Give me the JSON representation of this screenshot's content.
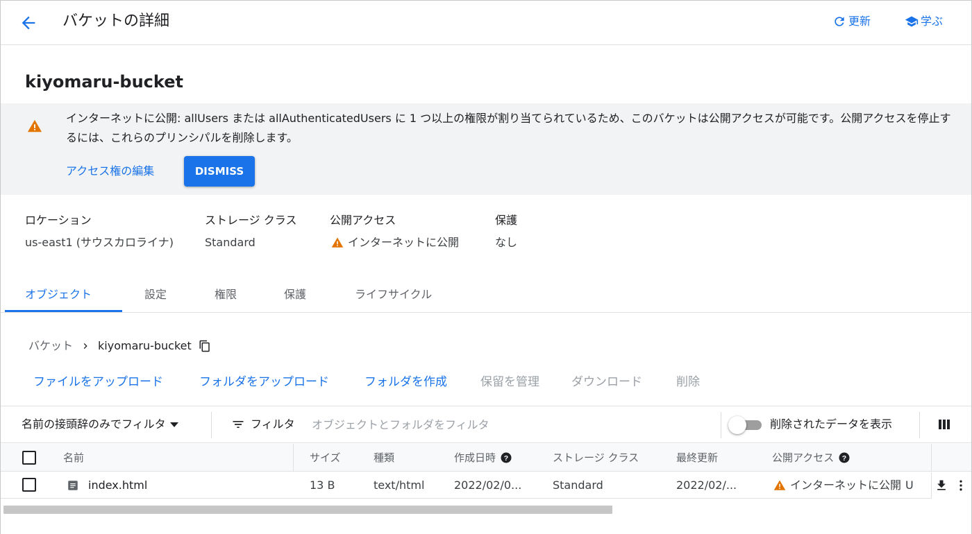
{
  "header": {
    "title": "バケットの詳細",
    "refresh_label": "更新",
    "learn_label": "学ぶ"
  },
  "bucket": {
    "name": "kiyomaru-bucket"
  },
  "banner": {
    "message": "インターネットに公開: allUsers または allAuthenticatedUsers に 1 つ以上の権限が割り当てられているため、このバケットは公開アクセスが可能です。公開アクセスを停止するには、これらのプリンシパルを削除します。",
    "edit_link": "アクセス権の編集",
    "dismiss": "DISMISS"
  },
  "info": {
    "location_label": "ロケーション",
    "location_value": "us-east1 (サウスカロライナ)",
    "storage_label": "ストレージ クラス",
    "storage_value": "Standard",
    "public_label": "公開アクセス",
    "public_value": "インターネットに公開",
    "protection_label": "保護",
    "protection_value": "なし"
  },
  "tabs": [
    "オブジェクト",
    "設定",
    "権限",
    "保護",
    "ライフサイクル"
  ],
  "breadcrumb": {
    "root": "バケット",
    "current": "kiyomaru-bucket"
  },
  "actions": {
    "upload_files": "ファイルをアップロード",
    "upload_folder": "フォルダをアップロード",
    "create_folder": "フォルダを作成",
    "manage_holds": "保留を管理",
    "download": "ダウンロード",
    "delete": "削除"
  },
  "filterbar": {
    "prefix_filter": "名前の接頭辞のみでフィルタ",
    "filter_label": "フィルタ",
    "filter_placeholder": "オブジェクトとフォルダをフィルタ",
    "toggle_label": "削除されたデータを表示"
  },
  "table": {
    "headers": {
      "name": "名前",
      "size": "サイズ",
      "type": "種類",
      "created": "作成日時",
      "storage_class": "ストレージ クラス",
      "last_modified": "最終更新",
      "public_access": "公開アクセス"
    },
    "rows": [
      {
        "name": "index.html",
        "size": "13 B",
        "type": "text/html",
        "created": "2022/02/0...",
        "storage_class": "Standard",
        "last_modified": "2022/02/...",
        "public_access": "インターネットに公開",
        "overflow": "U"
      }
    ]
  },
  "colors": {
    "accent": "#1a73e8",
    "warning": "#e37400"
  },
  "icons": [
    "back-arrow-icon",
    "refresh-icon",
    "school-icon",
    "warning-icon",
    "chevron-right-icon",
    "copy-icon",
    "filter-icon",
    "view-column-icon",
    "help-icon",
    "file-icon",
    "download-icon",
    "more-vert-icon"
  ]
}
